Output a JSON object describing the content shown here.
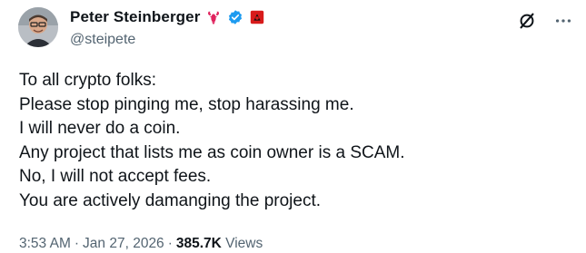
{
  "author": {
    "display_name": "Peter Steinberger",
    "handle": "@steipete"
  },
  "badges": [
    "lobster-icon",
    "verified-icon",
    "flag-icon"
  ],
  "actions": [
    "grok-icon",
    "more-icon"
  ],
  "tweet": {
    "lines": [
      "To all crypto folks:",
      "Please stop pinging me, stop harassing me.",
      "I will never do a coin.",
      "Any project that lists me as coin owner is a SCAM.",
      "No, I will not accept fees.",
      "You are actively damanging the project."
    ]
  },
  "meta": {
    "time": "3:53 AM",
    "separator": "·",
    "date": "Jan 27, 2026",
    "views_count": "385.7K",
    "views_label": "Views"
  },
  "colors": {
    "text": "#0f1419",
    "secondary": "#536471",
    "verified": "#1d9bf0",
    "lobster": "#e0245e",
    "flag": "#d81b1b"
  }
}
